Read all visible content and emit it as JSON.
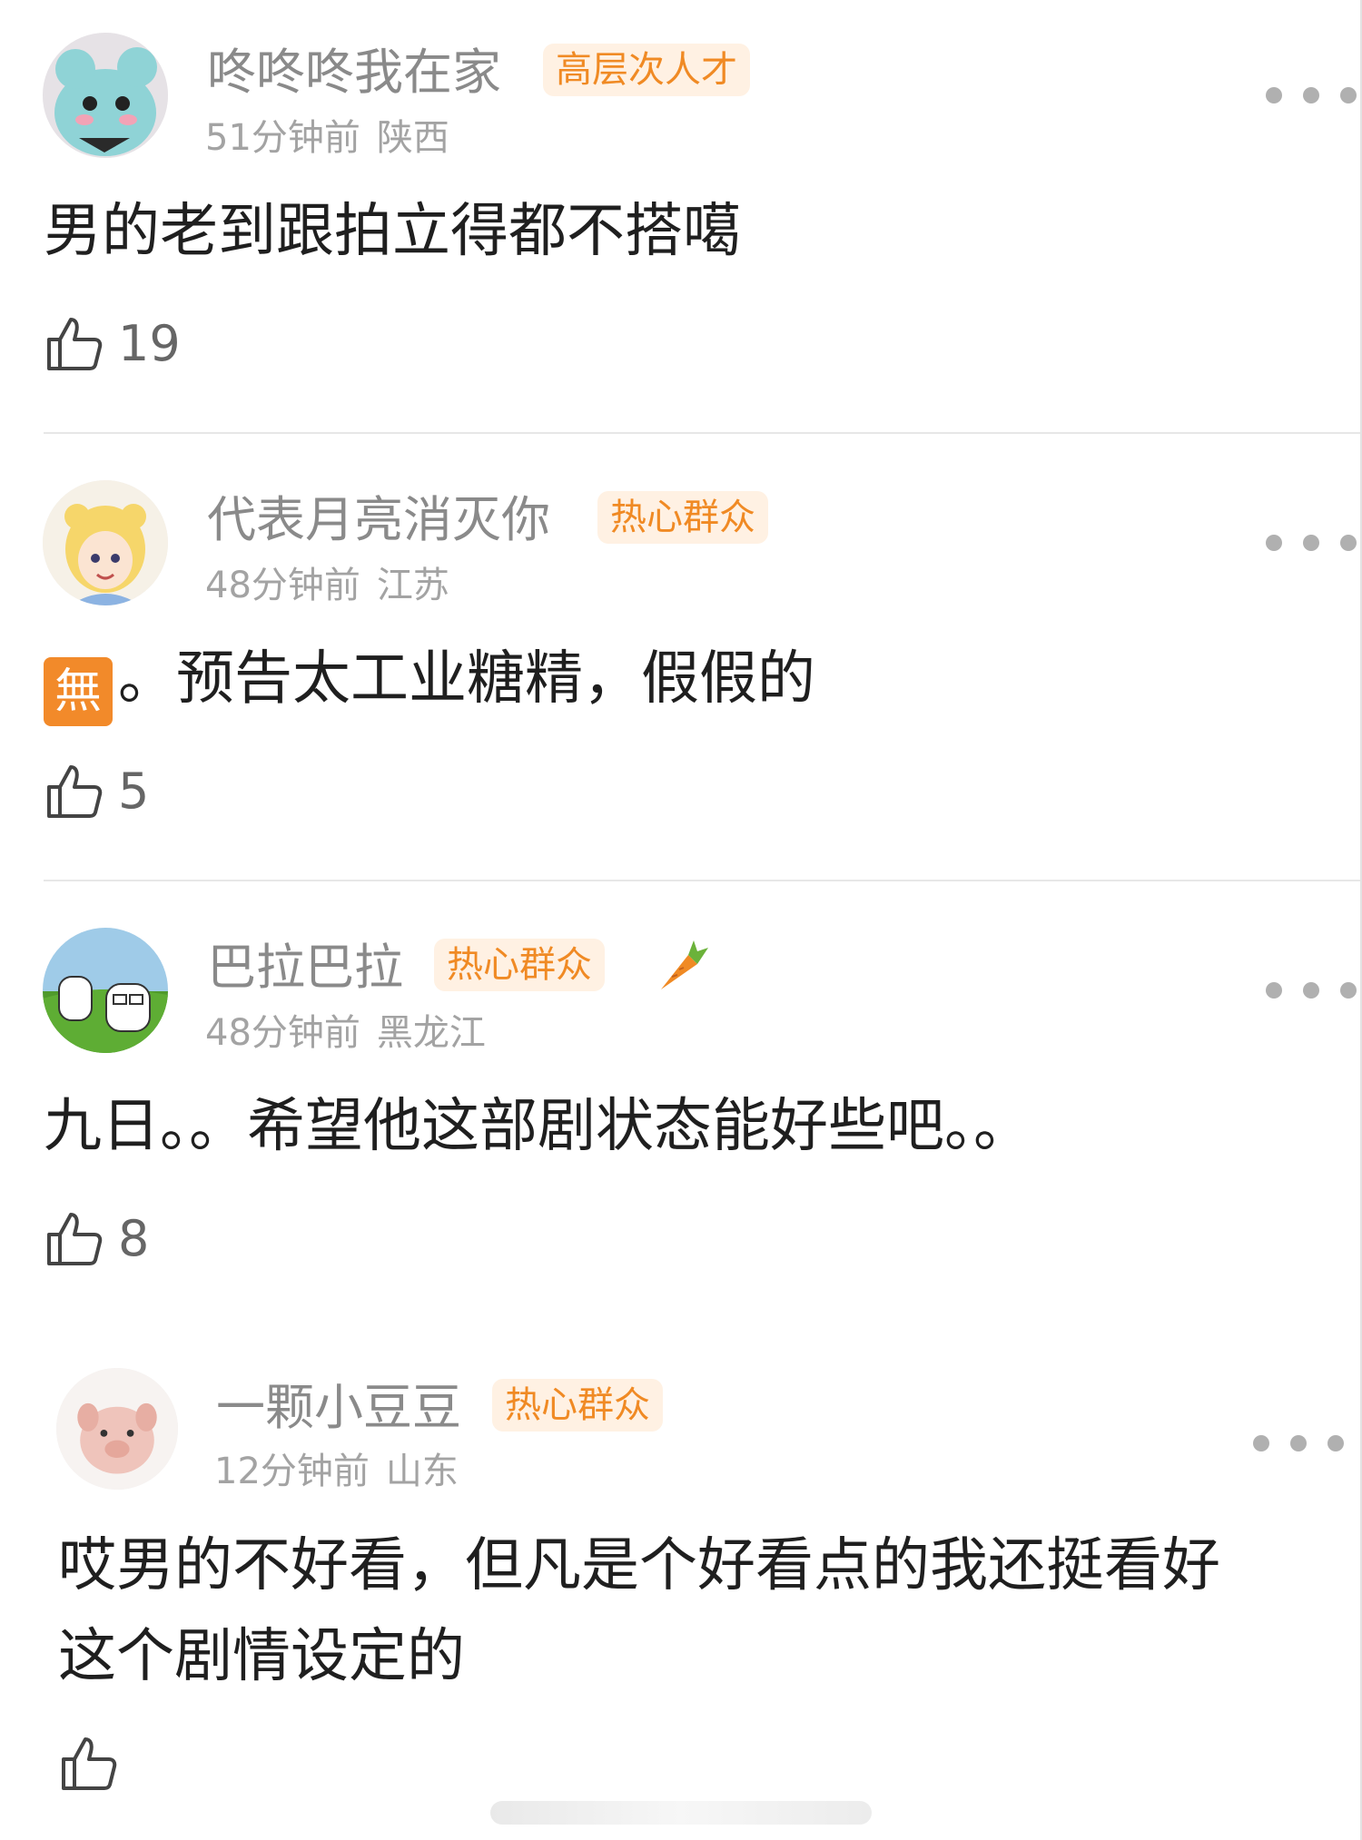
{
  "comments": [
    {
      "username": "咚咚咚我在家",
      "badge": "高层次人才",
      "time": "51分钟前",
      "location": "陕西",
      "text": "男的老到跟拍立得都不搭噶",
      "likes": "19",
      "avatar_icon": "plush-toy-icon"
    },
    {
      "username": "代表月亮消灭你",
      "badge": "热心群众",
      "time": "48分钟前",
      "location": "江苏",
      "emoji": "無",
      "text": "。预告太工业糖精，假假的",
      "likes": "5",
      "avatar_icon": "anime-girl-icon"
    },
    {
      "username": "巴拉巴拉",
      "badge": "热心群众",
      "time": "48分钟前",
      "location": "黑龙江",
      "text": "九日。。希望他这部剧状态能好些吧。。",
      "likes": "8",
      "avatar_icon": "cartoon-field-icon"
    },
    {
      "username": "一颗小豆豆",
      "badge": "热心群众",
      "time": "12分钟前",
      "location": "山东",
      "text_line1": "哎男的不好看，但凡是个好看点的我还挺看好",
      "text_line2": "这个剧情设定的",
      "likes": "",
      "avatar_icon": "pink-pig-icon"
    }
  ],
  "colors": {
    "badge_text": "#f08a24",
    "badge_bg": "#fff1e3",
    "username": "#8a8a8a",
    "meta": "#a3a3a3"
  }
}
